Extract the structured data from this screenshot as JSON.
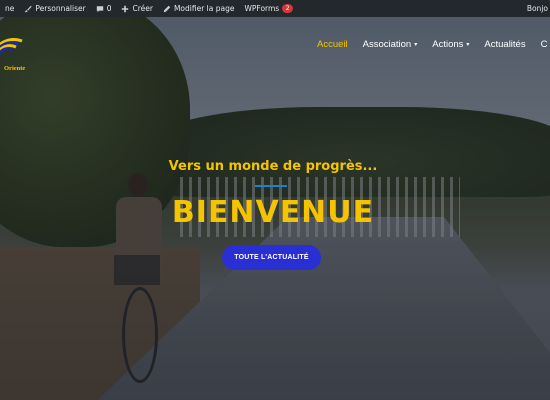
{
  "admin_bar": {
    "site_fragment": "ne",
    "customize_label": "Personnaliser",
    "comments_count": "0",
    "new_label": "Créer",
    "edit_label": "Modifier la page",
    "wpforms_label": "WPForms",
    "wpforms_badge": "2",
    "greeting": "Bonjo"
  },
  "logo": {
    "text": "Oriente"
  },
  "nav": {
    "items": [
      {
        "label": "Accueil",
        "active": true
      },
      {
        "label": "Association",
        "dropdown": true
      },
      {
        "label": "Actions",
        "dropdown": true
      },
      {
        "label": "Actualités"
      },
      {
        "label": "C"
      }
    ]
  },
  "hero": {
    "tagline": "Vers un monde de progrès...",
    "headline": "BIENVENUE",
    "cta_label": "TOUTE L'ACTUALITÉ"
  },
  "colors": {
    "accent": "#f5c400",
    "button": "#2a2fd3",
    "admin_bar": "#23282d",
    "badge": "#d63638"
  }
}
